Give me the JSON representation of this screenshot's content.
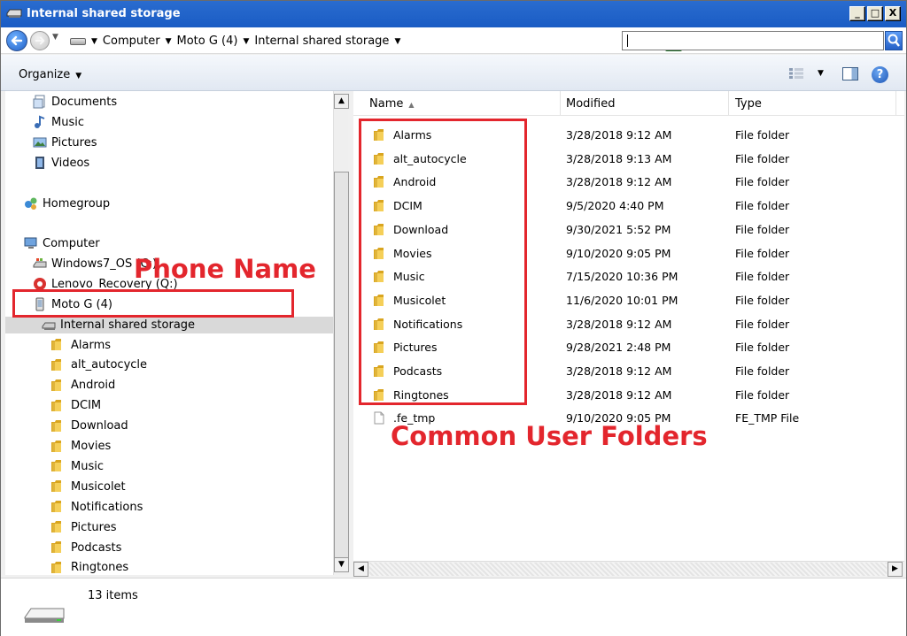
{
  "window": {
    "title": "Internal shared storage",
    "min_label": "_",
    "max_label": "□",
    "close_label": "X"
  },
  "address": {
    "crumbs": [
      "Computer",
      "Moto G (4)",
      "Internal shared storage"
    ],
    "search_placeholder": ""
  },
  "toolbar": {
    "organize_label": "Organize",
    "help_label": "?"
  },
  "nav": {
    "libraries": [
      "Documents",
      "Music",
      "Pictures",
      "Videos"
    ],
    "homegroup": "Homegroup",
    "computer": "Computer",
    "drives": [
      "Windows7_OS (C:)",
      "Lenovo_Recovery (Q:)"
    ],
    "device": "Moto G (4)",
    "storage": "Internal shared storage",
    "folders": [
      "Alarms",
      "alt_autocycle",
      "Android",
      "DCIM",
      "Download",
      "Movies",
      "Music",
      "Musicolet",
      "Notifications",
      "Pictures",
      "Podcasts",
      "Ringtones"
    ]
  },
  "columns": {
    "name": "Name",
    "modified": "Modified",
    "type": "Type"
  },
  "files": [
    {
      "name": "Alarms",
      "modified": "3/28/2018 9:12 AM",
      "type": "File folder",
      "icon": "folder-icon"
    },
    {
      "name": "alt_autocycle",
      "modified": "3/28/2018 9:13 AM",
      "type": "File folder",
      "icon": "folder-icon"
    },
    {
      "name": "Android",
      "modified": "3/28/2018 9:12 AM",
      "type": "File folder",
      "icon": "folder-icon"
    },
    {
      "name": "DCIM",
      "modified": "9/5/2020 4:40 PM",
      "type": "File folder",
      "icon": "folder-icon"
    },
    {
      "name": "Download",
      "modified": "9/30/2021 5:52 PM",
      "type": "File folder",
      "icon": "folder-icon"
    },
    {
      "name": "Movies",
      "modified": "9/10/2020 9:05 PM",
      "type": "File folder",
      "icon": "folder-icon"
    },
    {
      "name": "Music",
      "modified": "7/15/2020 10:36 PM",
      "type": "File folder",
      "icon": "folder-icon"
    },
    {
      "name": "Musicolet",
      "modified": "11/6/2020 10:01 PM",
      "type": "File folder",
      "icon": "folder-icon"
    },
    {
      "name": "Notifications",
      "modified": "3/28/2018 9:12 AM",
      "type": "File folder",
      "icon": "folder-icon"
    },
    {
      "name": "Pictures",
      "modified": "9/28/2021 2:48 PM",
      "type": "File folder",
      "icon": "folder-icon"
    },
    {
      "name": "Podcasts",
      "modified": "3/28/2018 9:12 AM",
      "type": "File folder",
      "icon": "folder-icon"
    },
    {
      "name": "Ringtones",
      "modified": "3/28/2018 9:12 AM",
      "type": "File folder",
      "icon": "folder-icon"
    },
    {
      "name": ".fe_tmp",
      "modified": "9/10/2020 9:05 PM",
      "type": "FE_TMP File",
      "icon": "file-icon"
    }
  ],
  "status": {
    "item_count": "13 items"
  },
  "annotations": {
    "phone_name": "Phone Name",
    "common_folders": "Common User Folders",
    "color": "#e3262d"
  }
}
